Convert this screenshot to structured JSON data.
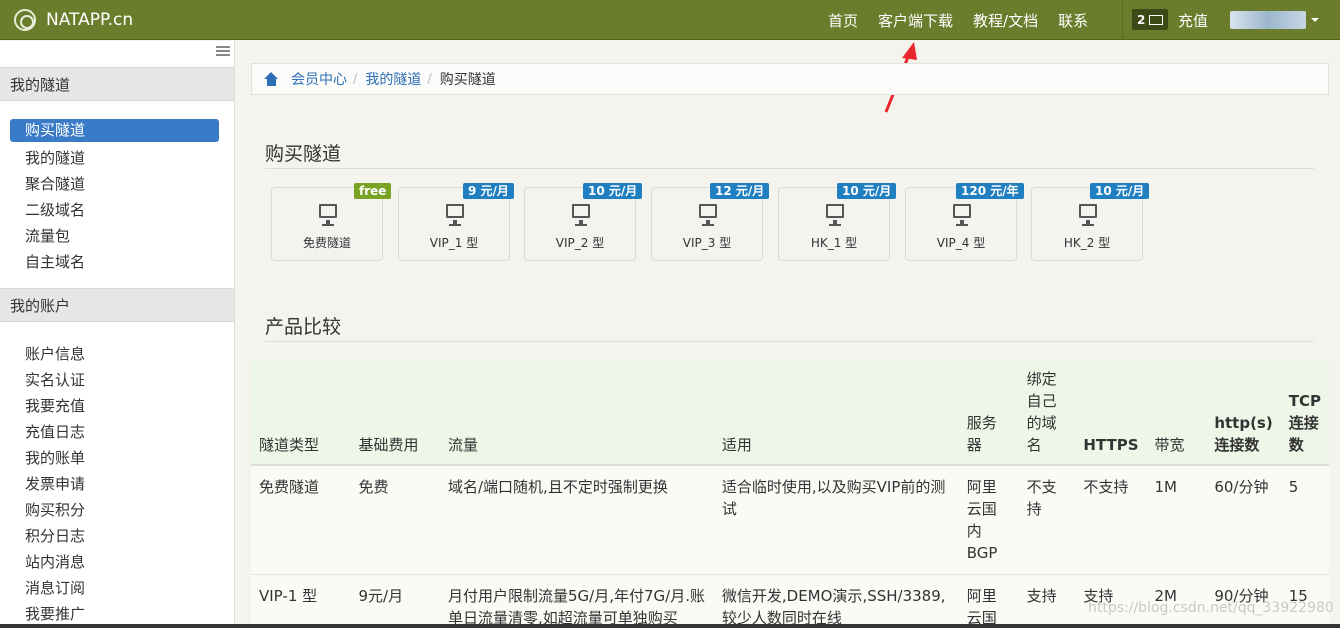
{
  "navbar": {
    "brand": "NATAPP.cn",
    "links": [
      "首页",
      "客户端下载",
      "教程/文档",
      "联系"
    ],
    "msg_count": "2",
    "recharge": "充值"
  },
  "sidebar": {
    "section1": "我的隧道",
    "tunnel_items": [
      "购买隧道",
      "我的隧道",
      "聚合隧道",
      "二级域名",
      "流量包",
      "自主域名"
    ],
    "section2": "我的账户",
    "account_items": [
      "账户信息",
      "实名认证",
      "我要充值",
      "充值日志",
      "我的账单",
      "发票申请",
      "购买积分",
      "积分日志",
      "站内消息",
      "消息订阅",
      "我要推广"
    ]
  },
  "breadcrumb": [
    "会员中心",
    "我的隧道",
    "购买隧道"
  ],
  "buy_section": {
    "title": "购买隧道",
    "cards": [
      {
        "name": "免费隧道",
        "badge": "free"
      },
      {
        "name": "VIP_1 型",
        "badge": "9 元/月"
      },
      {
        "name": "VIP_2 型",
        "badge": "10 元/月"
      },
      {
        "name": "VIP_3 型",
        "badge": "12 元/月"
      },
      {
        "name": "HK_1 型",
        "badge": "10 元/月"
      },
      {
        "name": "VIP_4 型",
        "badge": "120 元/年"
      },
      {
        "name": "HK_2 型",
        "badge": "10 元/月"
      }
    ]
  },
  "compare_section": {
    "title": "产品比较",
    "headers": [
      "隧道类型",
      "基础费用",
      "流量",
      "适用",
      "服务器",
      "绑定自己的域名",
      "HTTPS",
      "带宽",
      "http(s)连接数",
      "TCP连接数"
    ],
    "rows": [
      [
        "免费隧道",
        "免费",
        "域名/端口随机,且不定时强制更换",
        "适合临时使用,以及购买VIP前的测试",
        "阿里云国内BGP",
        "不支持",
        "不支持",
        "1M",
        "60/分钟",
        "5"
      ],
      [
        "VIP-1 型",
        "9元/月",
        "月付用户限制流量5G/月,年付7G/月.账单日流量清零,如超流量可单独购买",
        "微信开发,DEMO演示,SSH/3389,较少人数同时在线",
        "阿里云国",
        "支持",
        "支持",
        "2M",
        "90/分钟",
        "15"
      ]
    ]
  },
  "watermark": "https://blog.csdn.net/qq_33922980"
}
